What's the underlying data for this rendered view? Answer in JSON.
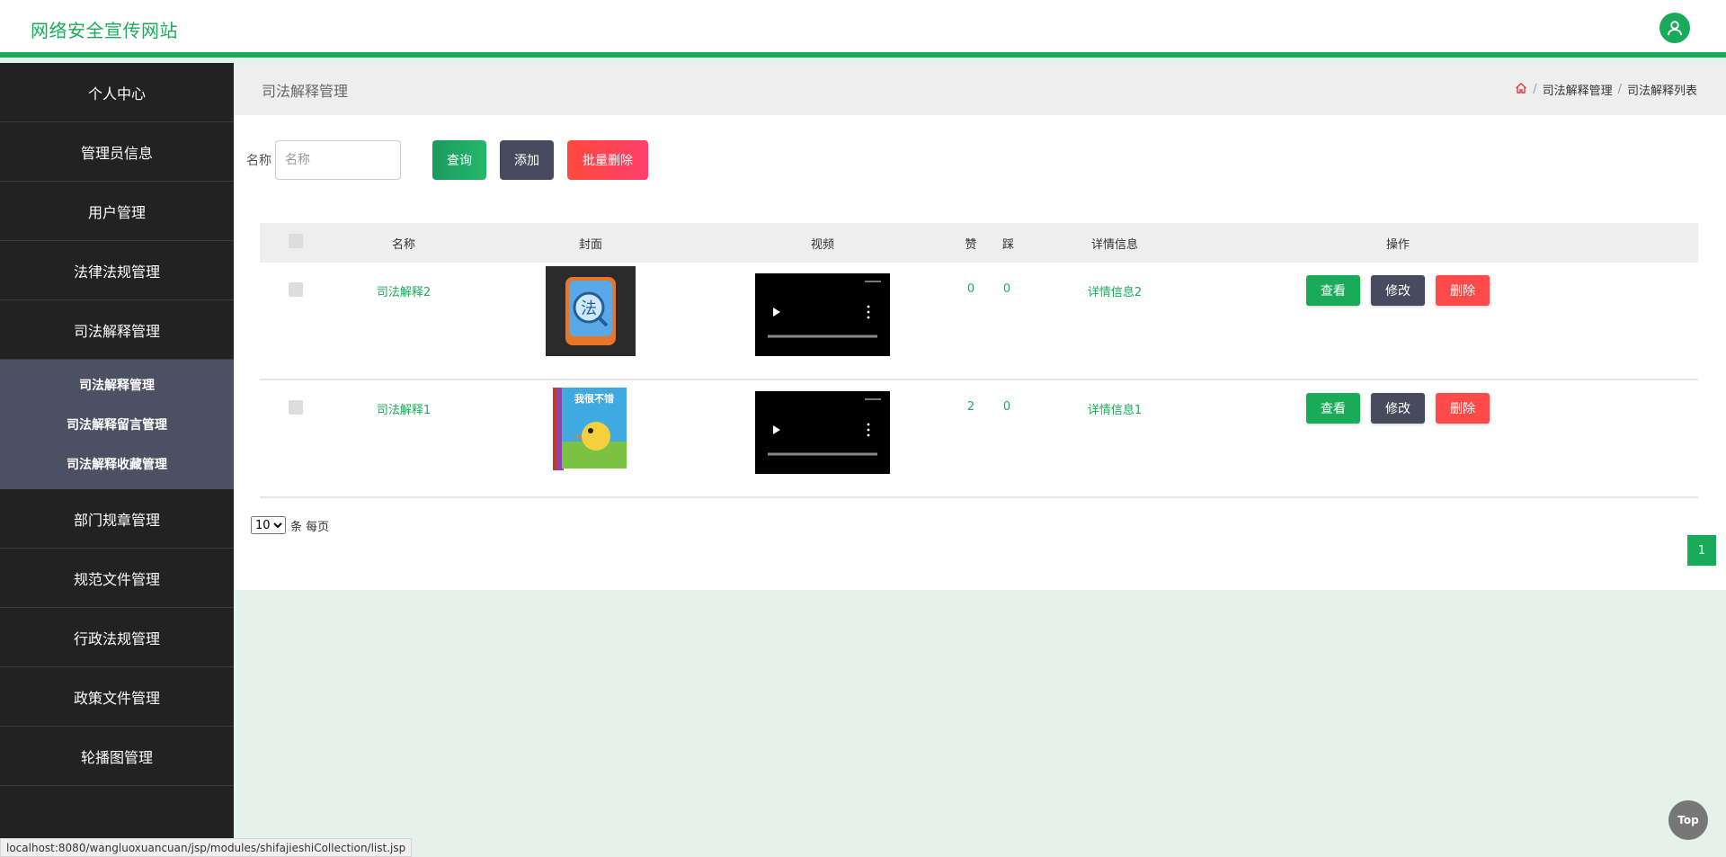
{
  "header": {
    "site_title": "网络安全宣传网站"
  },
  "sidebar": {
    "items_before": [
      {
        "label": "个人中心"
      },
      {
        "label": "管理员信息"
      },
      {
        "label": "用户管理"
      },
      {
        "label": "法律法规管理"
      },
      {
        "label": "司法解释管理"
      }
    ],
    "submenu": [
      {
        "label": "司法解释管理"
      },
      {
        "label": "司法解释留言管理"
      },
      {
        "label": "司法解释收藏管理"
      }
    ],
    "items_after": [
      {
        "label": "部门规章管理"
      },
      {
        "label": "规范文件管理"
      },
      {
        "label": "行政法规管理"
      },
      {
        "label": "政策文件管理"
      },
      {
        "label": "轮播图管理"
      }
    ]
  },
  "page": {
    "title": "司法解释管理",
    "breadcrumb": [
      "司法解释管理",
      "司法解释列表"
    ],
    "breadcrumb_sep": "/"
  },
  "search": {
    "label": "名称",
    "placeholder": "名称",
    "value": "",
    "query_label": "查询",
    "add_label": "添加",
    "batch_delete_label": "批量删除"
  },
  "table": {
    "headers": {
      "name": "名称",
      "cover": "封面",
      "video": "视频",
      "like": "赞",
      "tread": "踩",
      "detail": "详情信息",
      "ops": "操作"
    },
    "rows": [
      {
        "name": "司法解释2",
        "like": "0",
        "tread": "0",
        "detail": "详情信息2",
        "cover_text": "法"
      },
      {
        "name": "司法解释1",
        "like": "2",
        "tread": "0",
        "detail": "详情信息1",
        "cover_text": "我很不错"
      }
    ],
    "ops": {
      "view": "查看",
      "edit": "修改",
      "delete": "删除"
    }
  },
  "pager": {
    "page_size": "10",
    "page_size_options": [
      "10"
    ],
    "per_page_label": "条 每页",
    "current_page": "1"
  },
  "statusbar": {
    "url": "localhost:8080/wangluoxuancuan/jsp/modules/shifajieshiCollection/list.jsp"
  },
  "top_button": {
    "label": "Top"
  },
  "colors": {
    "accent": "#1aab5a",
    "dark": "#222222",
    "danger": "#ff4a4a"
  }
}
